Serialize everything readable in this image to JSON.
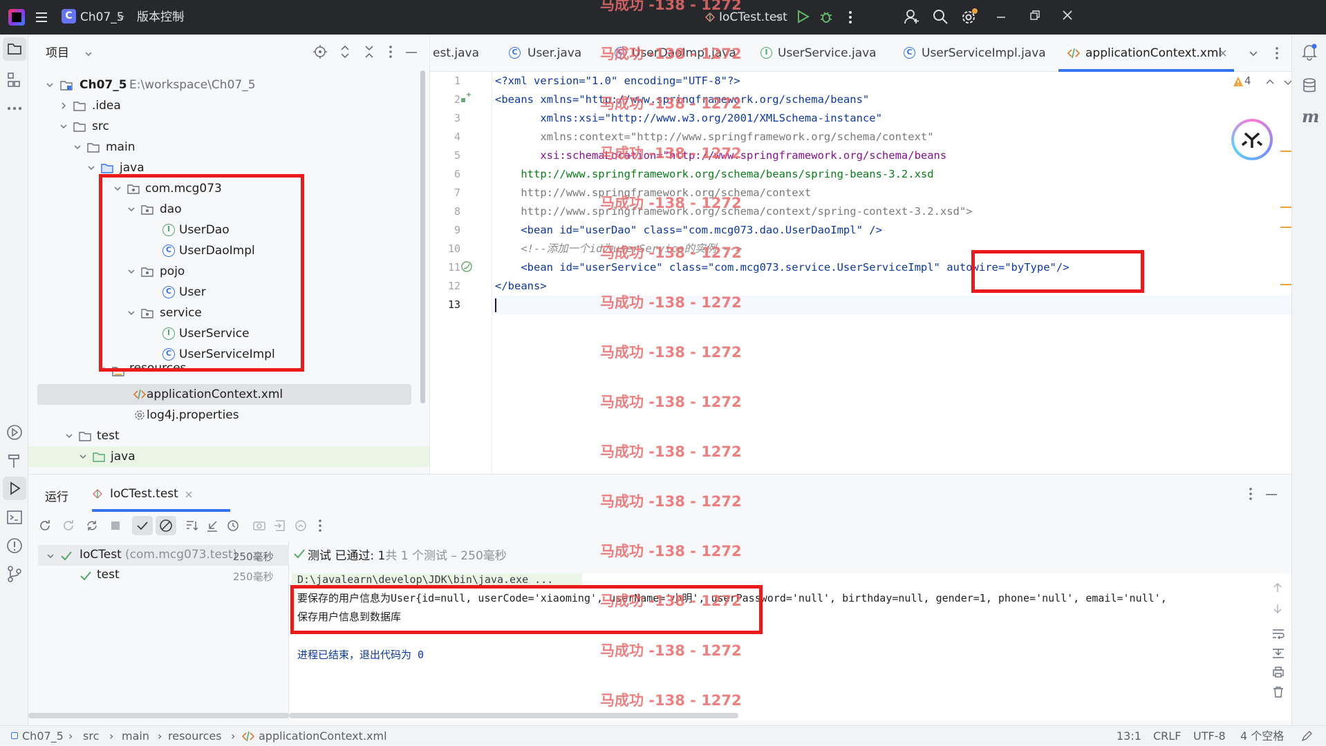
{
  "titlebar": {
    "project_badge": "C",
    "project_name": "Ch07_5",
    "vcs_menu": "版本控制",
    "run_config": "IoCTest.test"
  },
  "project_panel": {
    "title": "项目",
    "tree": [
      {
        "label": "Ch07_5",
        "suffix": "E:\\workspace\\Ch07_5"
      },
      {
        "label": ".idea"
      },
      {
        "label": "src"
      },
      {
        "label": "main"
      },
      {
        "label": "java"
      },
      {
        "label": "com.mcg073"
      },
      {
        "label": "dao"
      },
      {
        "label": "UserDao"
      },
      {
        "label": "UserDaoImpl"
      },
      {
        "label": "pojo"
      },
      {
        "label": "User"
      },
      {
        "label": "service"
      },
      {
        "label": "UserService"
      },
      {
        "label": "UserServiceImpl"
      },
      {
        "label": "resources"
      },
      {
        "label": "applicationContext.xml"
      },
      {
        "label": "log4j.properties"
      },
      {
        "label": "test"
      },
      {
        "label": "java"
      }
    ]
  },
  "editor": {
    "tabs": [
      {
        "label": "est.java"
      },
      {
        "label": "User.java"
      },
      {
        "label": "UserDaoImpl.java"
      },
      {
        "label": "UserService.java"
      },
      {
        "label": "UserServiceImpl.java"
      },
      {
        "label": "applicationContext.xml",
        "active": true
      }
    ],
    "warning_count": "4",
    "line_numbers": [
      "1",
      "2",
      "3",
      "4",
      "5",
      "6",
      "7",
      "8",
      "9",
      "10",
      "11",
      "12",
      "13"
    ],
    "lines": [
      "<?xml version=\"1.0\" encoding=\"UTF-8\"?>",
      "<beans xmlns=\"http://www.springframework.org/schema/beans\"",
      "       xmlns:xsi=\"http://www.w3.org/2001/XMLSchema-instance\"",
      "       xmlns:context=\"http://www.springframework.org/schema/context\"",
      "       xsi:schemaLocation=\"http://www.springframework.org/schema/beans",
      "    http://www.springframework.org/schema/beans/spring-beans-3.2.xsd",
      "    http://www.springframework.org/schema/context",
      "    http://www.springframework.org/schema/context/spring-context-3.2.xsd\">",
      "    <bean id=\"userDao\" class=\"com.mcg073.dao.UserDaoImpl\" />",
      "    <!--添加一个id为userService的实例 -->",
      "    <bean id=\"userService\" class=\"com.mcg073.service.UserServiceImpl\" autowire=\"byType\"/>",
      "</beans>",
      ""
    ]
  },
  "run_panel": {
    "title": "运行",
    "tab": "IoCTest.test",
    "test_root": "IoCTest",
    "test_root_pkg": "(com.mcg073.test)",
    "test_root_time": "250毫秒",
    "test_child": "test",
    "test_child_time": "250毫秒",
    "summary_prefix": "测试 已通过: ",
    "summary_count": "1",
    "summary_suffix": "共 1 个测试 – 250毫秒",
    "console": [
      "D:\\javalearn\\develop\\JDK\\bin\\java.exe ...",
      "要保存的用户信息为User{id=null, userCode='xiaoming', userName='小明', userPassword='null', birthday=null, gender=1, phone='null', email='null',",
      "保存用户信息到数据库",
      "",
      "进程已结束，退出代码为 0"
    ]
  },
  "watermark": "马成功 -138 - 1272",
  "statusbar": {
    "breadcrumbs": [
      "Ch07_5",
      "src",
      "main",
      "resources",
      "applicationContext.xml"
    ],
    "position": "13:1",
    "line_ending": "CRLF",
    "encoding": "UTF-8",
    "indent": "4 个空格"
  },
  "colors": {
    "highlight_box": "#ec1b1b",
    "accent": "#3574f0"
  }
}
